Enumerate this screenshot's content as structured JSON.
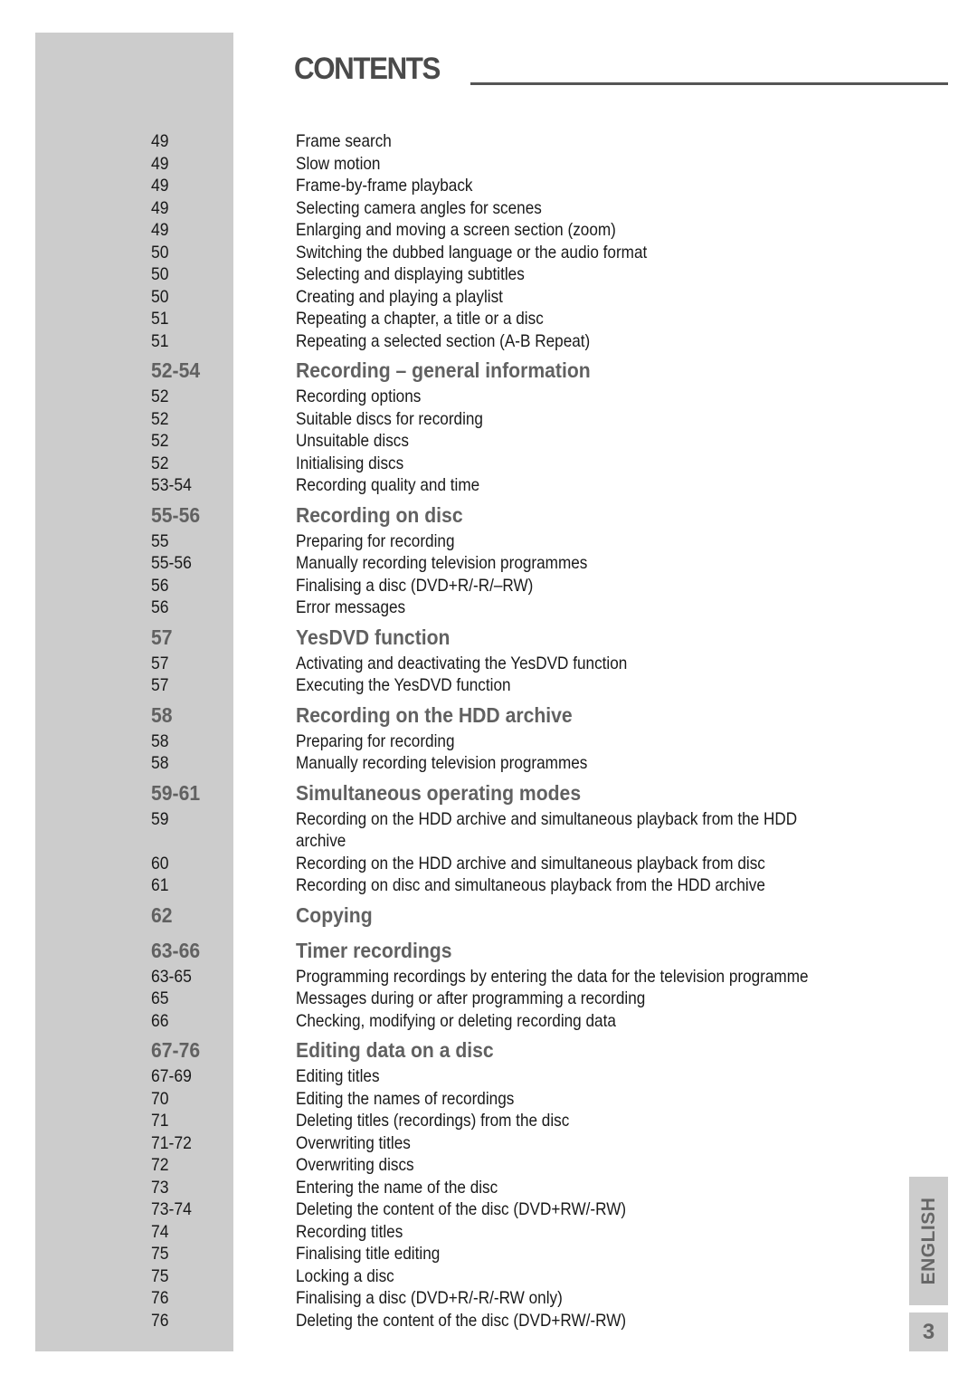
{
  "header": {
    "title": "CONTENTS"
  },
  "side_tab": {
    "language": "ENGLISH",
    "page_number": "3"
  },
  "colors": {
    "sidebar": "#cccccc",
    "heading": "#616161",
    "body_text": "#1a1a1a"
  },
  "toc": [
    {
      "type": "item",
      "page": "49",
      "text": "Frame search"
    },
    {
      "type": "item",
      "page": "49",
      "text": "Slow motion"
    },
    {
      "type": "item",
      "page": "49",
      "text": "Frame-by-frame playback"
    },
    {
      "type": "item",
      "page": "49",
      "text": "Selecting camera angles for scenes"
    },
    {
      "type": "item",
      "page": "49",
      "text": "Enlarging and moving a screen section (zoom)"
    },
    {
      "type": "item",
      "page": "50",
      "text": "Switching the dubbed language or the audio format"
    },
    {
      "type": "item",
      "page": "50",
      "text": "Selecting and displaying subtitles"
    },
    {
      "type": "item",
      "page": "50",
      "text": "Creating and playing a playlist"
    },
    {
      "type": "item",
      "page": "51",
      "text": "Repeating a chapter, a title or a disc"
    },
    {
      "type": "item",
      "page": "51",
      "text": "Repeating a selected section (A-B Repeat)"
    },
    {
      "type": "head",
      "page": "52-54",
      "text": "Recording – general information"
    },
    {
      "type": "item",
      "page": "52",
      "text": "Recording options"
    },
    {
      "type": "item",
      "page": "52",
      "text": "Suitable discs for recording"
    },
    {
      "type": "item",
      "page": "52",
      "text": "Unsuitable discs"
    },
    {
      "type": "item",
      "page": "52",
      "text": "Initialising discs"
    },
    {
      "type": "item",
      "page": "53-54",
      "text": "Recording quality and time"
    },
    {
      "type": "head",
      "page": "55-56",
      "text": "Recording on disc"
    },
    {
      "type": "item",
      "page": "55",
      "text": "Preparing for recording"
    },
    {
      "type": "item",
      "page": "55-56",
      "text": "Manually recording television programmes"
    },
    {
      "type": "item",
      "page": "56",
      "text": "Finalising a disc (DVD+R/-R/–RW)"
    },
    {
      "type": "item",
      "page": "56",
      "text": "Error messages"
    },
    {
      "type": "head",
      "page": "57",
      "text": "YesDVD function"
    },
    {
      "type": "item",
      "page": "57",
      "text": "Activating and deactivating the YesDVD function"
    },
    {
      "type": "item",
      "page": "57",
      "text": "Executing the YesDVD function"
    },
    {
      "type": "head",
      "page": "58",
      "text": "Recording on the HDD archive"
    },
    {
      "type": "item",
      "page": "58",
      "text": "Preparing for recording"
    },
    {
      "type": "item",
      "page": "58",
      "text": "Manually recording television programmes"
    },
    {
      "type": "head",
      "page": "59-61",
      "text": "Simultaneous operating modes"
    },
    {
      "type": "wrap",
      "page": "59",
      "text": "Recording on the HDD archive and simultaneous playback from the HDD archive"
    },
    {
      "type": "item",
      "page": "60",
      "text": "Recording on the HDD archive and simultaneous playback from disc"
    },
    {
      "type": "item",
      "page": "61",
      "text": "Recording on disc and simultaneous playback from the HDD archive"
    },
    {
      "type": "head-solo",
      "page": "62",
      "text": "Copying"
    },
    {
      "type": "head",
      "page": "63-66",
      "text": "Timer recordings"
    },
    {
      "type": "item",
      "page": "63-65",
      "text": "Programming recordings by entering the data for the television programme"
    },
    {
      "type": "item",
      "page": "65",
      "text": "Messages during or after programming a recording"
    },
    {
      "type": "item",
      "page": "66",
      "text": "Checking, modifying or deleting recording data"
    },
    {
      "type": "head",
      "page": "67-76",
      "text": "Editing data on a disc"
    },
    {
      "type": "item",
      "page": "67-69",
      "text": "Editing titles"
    },
    {
      "type": "item",
      "page": "70",
      "text": "Editing the names of recordings"
    },
    {
      "type": "item",
      "page": "71",
      "text": "Deleting titles (recordings) from the disc"
    },
    {
      "type": "item",
      "page": "71-72",
      "text": "Overwriting titles"
    },
    {
      "type": "item",
      "page": "72",
      "text": "Overwriting discs"
    },
    {
      "type": "item",
      "page": "73",
      "text": "Entering the name of the disc"
    },
    {
      "type": "item",
      "page": "73-74",
      "text": "Deleting the content of the disc (DVD+RW/-RW)"
    },
    {
      "type": "item",
      "page": "74",
      "text": "Recording titles"
    },
    {
      "type": "item",
      "page": "75",
      "text": "Finalising title editing"
    },
    {
      "type": "item",
      "page": "75",
      "text": "Locking a disc"
    },
    {
      "type": "item",
      "page": "76",
      "text": "Finalising a disc (DVD+R/-R/-RW only)"
    },
    {
      "type": "item",
      "page": "76",
      "text": "Deleting the content of the disc (DVD+RW/-RW)"
    }
  ]
}
